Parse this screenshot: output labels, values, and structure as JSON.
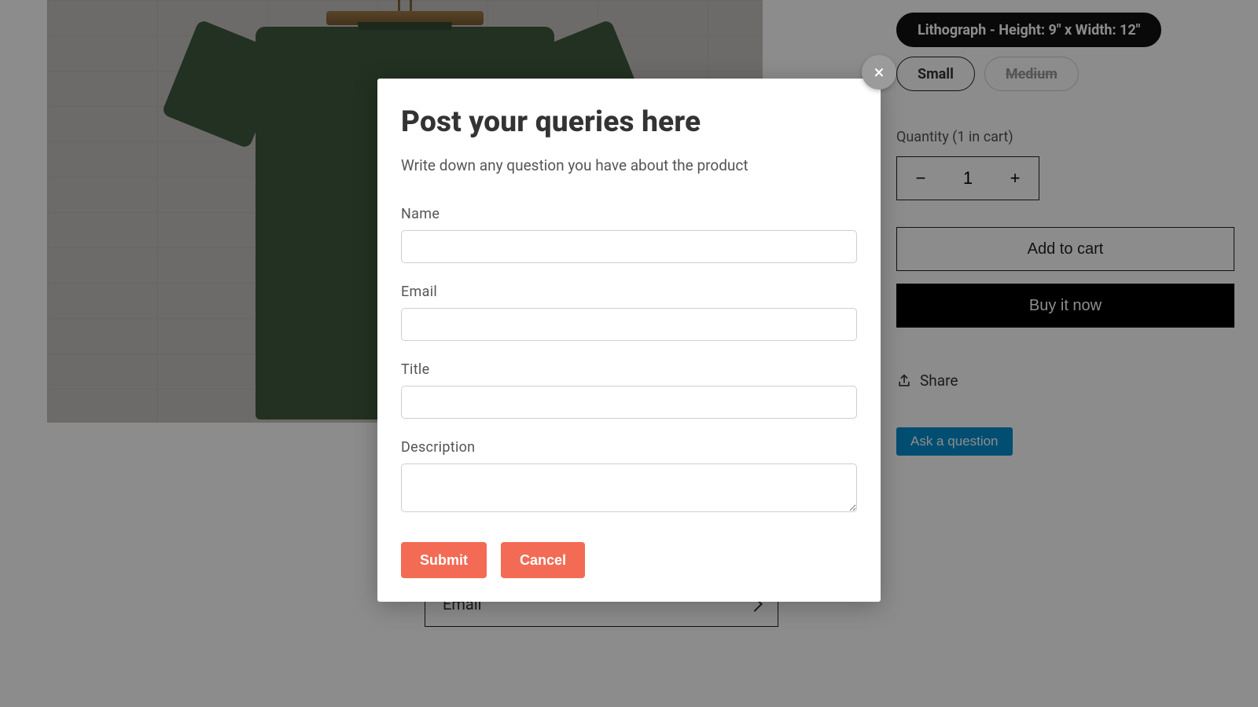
{
  "modal": {
    "title": "Post your queries here",
    "subtitle": "Write down any question you have about the product",
    "labels": {
      "name": "Name",
      "email": "Email",
      "title": "Title",
      "description": "Description"
    },
    "values": {
      "name": "",
      "email": "",
      "title": "",
      "description": ""
    },
    "submit": "Submit",
    "cancel": "Cancel",
    "close_glyph": "×"
  },
  "product": {
    "variants": {
      "primary": "Lithograph - Height: 9\" x Width: 12\"",
      "size_small": "Small",
      "size_medium": "Medium"
    },
    "quantity": {
      "label": "Quantity (1 in cart)",
      "value": "1",
      "minus": "−",
      "plus": "+"
    },
    "add_to_cart": "Add to cart",
    "buy_now": "Buy it now",
    "share": "Share",
    "ask_question": "Ask a question"
  },
  "footer": {
    "email_label": "Email"
  }
}
